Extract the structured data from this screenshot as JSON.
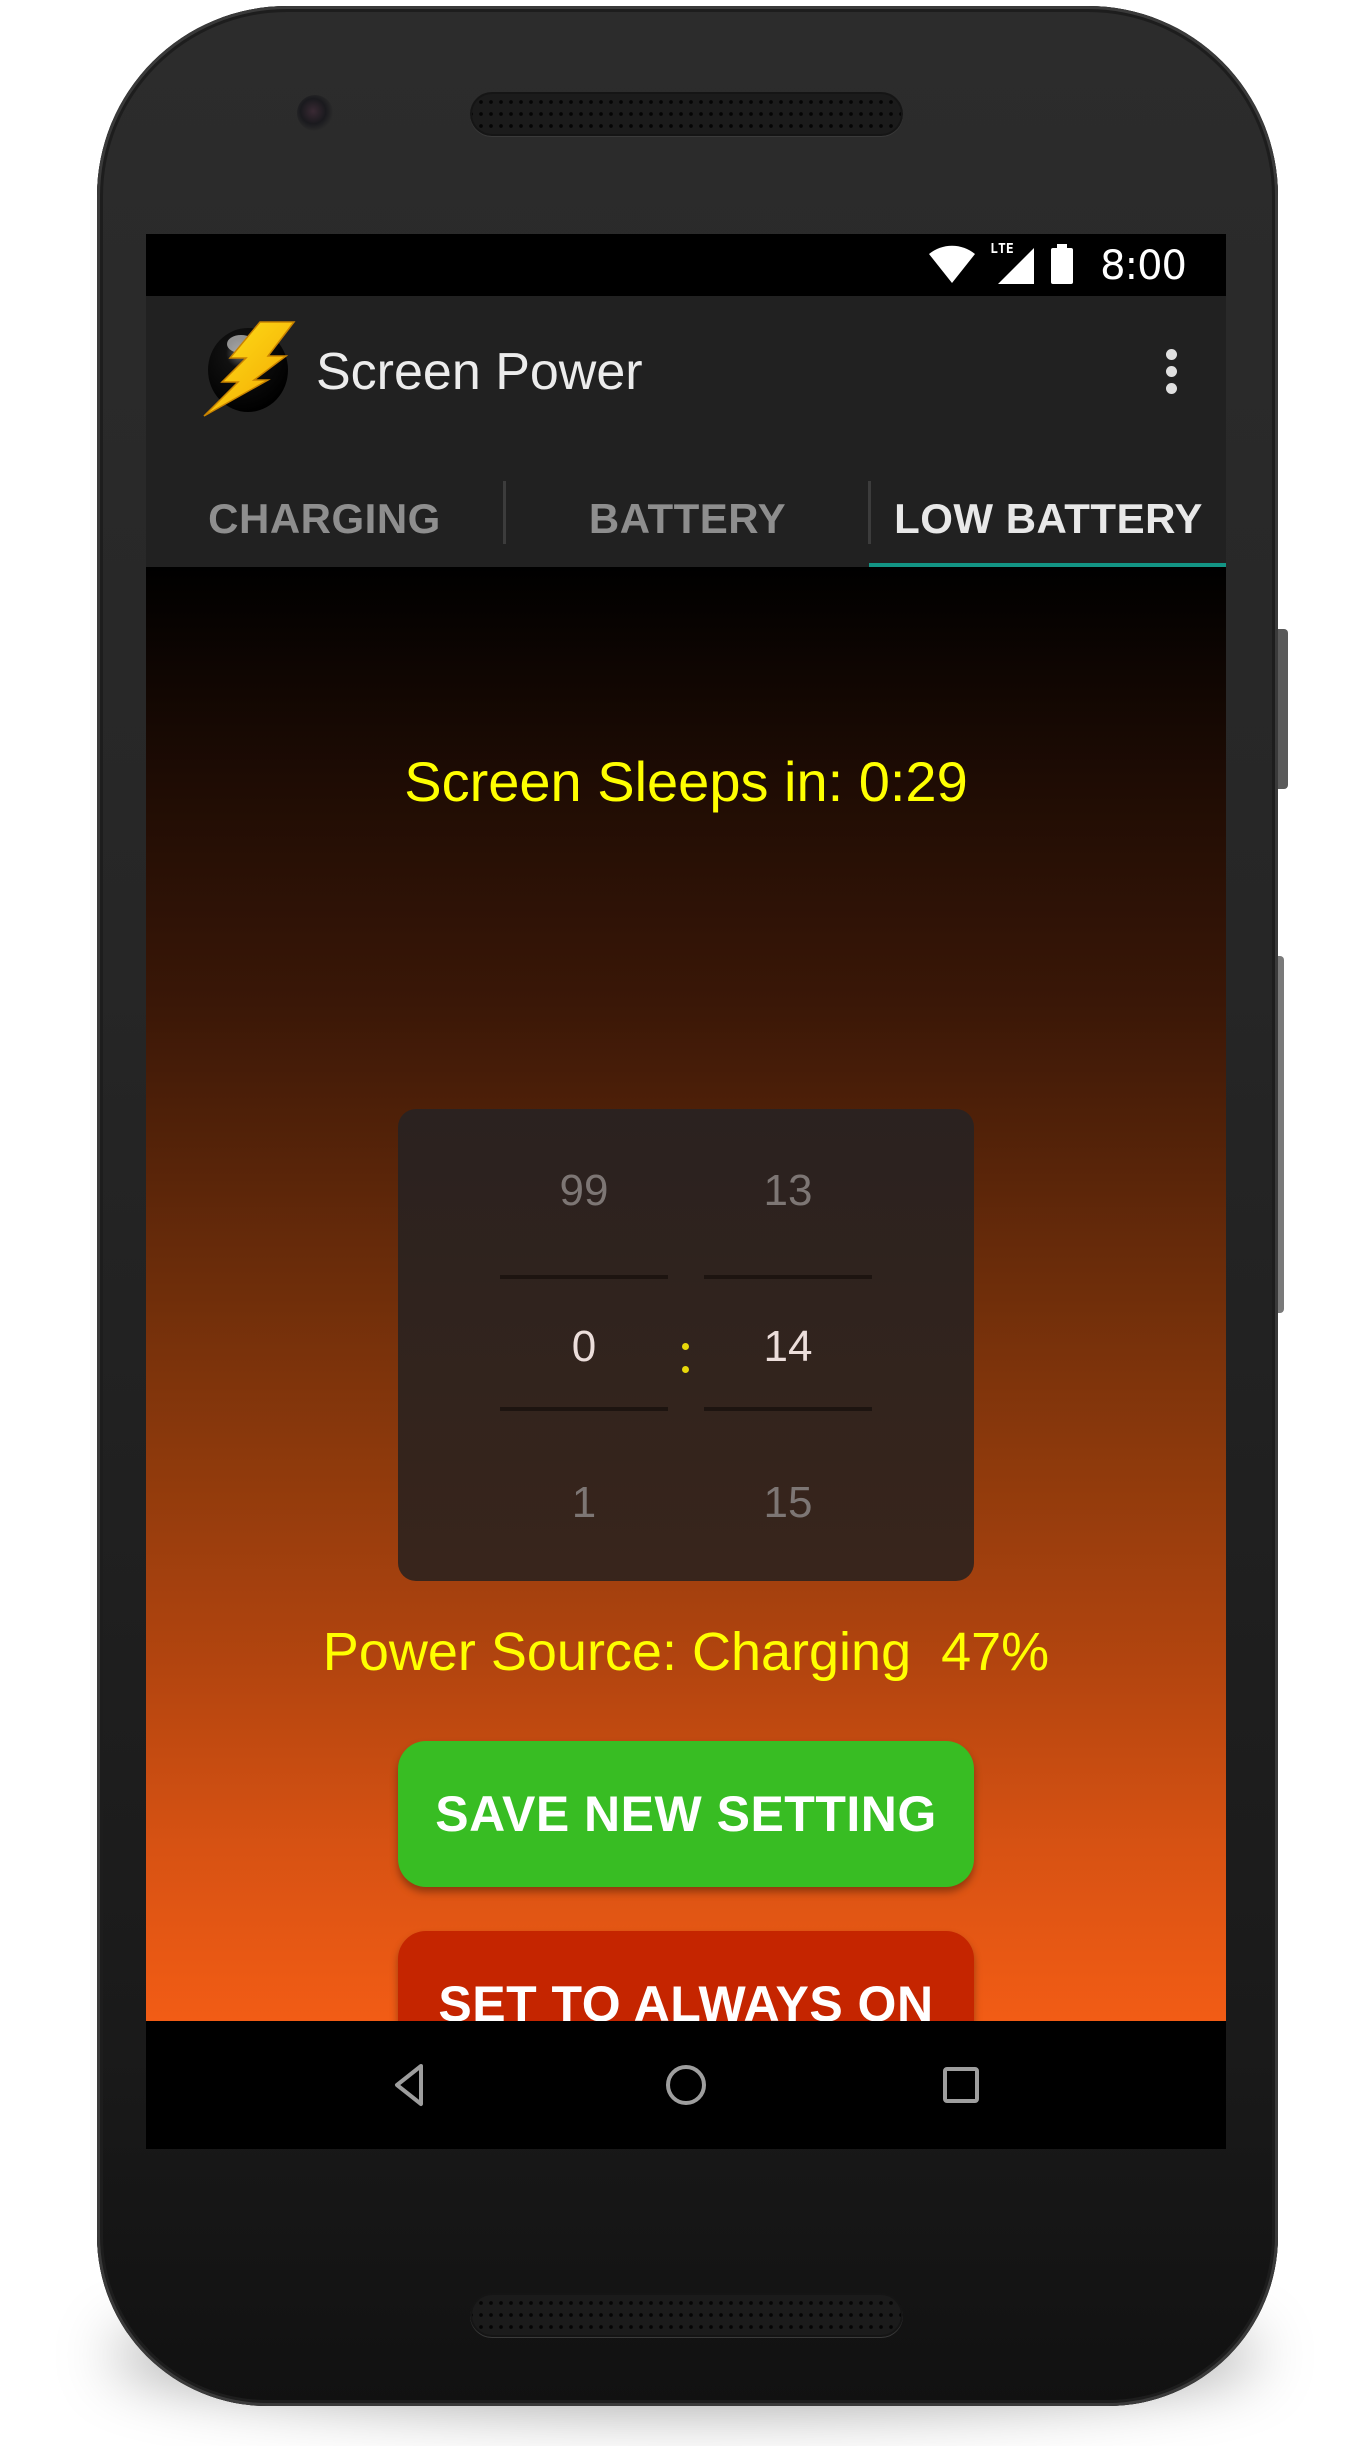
{
  "status_bar": {
    "time": "8:00",
    "network_label": "LTE",
    "icons": [
      "wifi-icon",
      "cell-signal-icon",
      "battery-icon"
    ]
  },
  "app_bar": {
    "title": "Screen Power",
    "app_icon": "lightning-bolt-icon",
    "menu_icon": "overflow-menu-icon"
  },
  "tabs": [
    {
      "label": "CHARGING",
      "active": false
    },
    {
      "label": "BATTERY",
      "active": false
    },
    {
      "label": "LOW BATTERY",
      "active": true
    }
  ],
  "main": {
    "sleep_label": "Screen Sleeps in: 0:29",
    "picker": {
      "separator": ":",
      "minutes": {
        "prev": "99",
        "current": "0",
        "next": "1"
      },
      "seconds": {
        "prev": "13",
        "current": "14",
        "next": "15"
      }
    },
    "power_source": "Power Source: Charging  47%",
    "buttons": {
      "save": "SAVE NEW SETTING",
      "always_on": "SET TO ALWAYS ON"
    }
  },
  "nav_bar": {
    "icons": [
      "back-icon",
      "home-icon",
      "recents-icon"
    ]
  },
  "colors": {
    "accent_tab_indicator": "#139585",
    "label_yellow": "#ffff00",
    "save_green": "#38bd23",
    "always_on_red": "#c52500",
    "gradient_bottom": "#f25c15"
  }
}
